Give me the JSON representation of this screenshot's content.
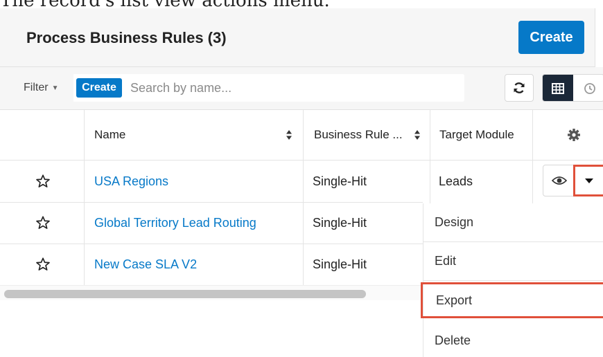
{
  "caption": "The record's list view actions menu.",
  "header": {
    "title": "Process Business Rules (3)",
    "create_label": "Create"
  },
  "filter_bar": {
    "filter_label": "Filter",
    "create_label": "Create",
    "search_placeholder": "Search by name...",
    "search_value": ""
  },
  "columns": [
    {
      "label": "Name"
    },
    {
      "label": "Business Rule ..."
    },
    {
      "label": "Target Module"
    }
  ],
  "rows": [
    {
      "name": "USA Regions",
      "type": "Single-Hit",
      "module": "Leads"
    },
    {
      "name": "Global Territory Lead Routing",
      "type": "Single-Hit",
      "module": ""
    },
    {
      "name": "New Case SLA V2",
      "type": "Single-Hit",
      "module": ""
    }
  ],
  "actions_menu": {
    "items": [
      {
        "label": "Design"
      },
      {
        "label": "Edit"
      },
      {
        "label": "Export",
        "highlighted": true
      },
      {
        "label": "Delete"
      }
    ]
  },
  "colors": {
    "accent": "#0679c8",
    "highlight": "#e0503a",
    "dark_toggle": "#1b2838"
  },
  "icons": [
    "favorite-star-icon",
    "sort-icon",
    "refresh-icon",
    "table-view-icon",
    "activity-clock-icon",
    "settings-gear-icon",
    "preview-eye-icon",
    "caret-down-icon"
  ]
}
